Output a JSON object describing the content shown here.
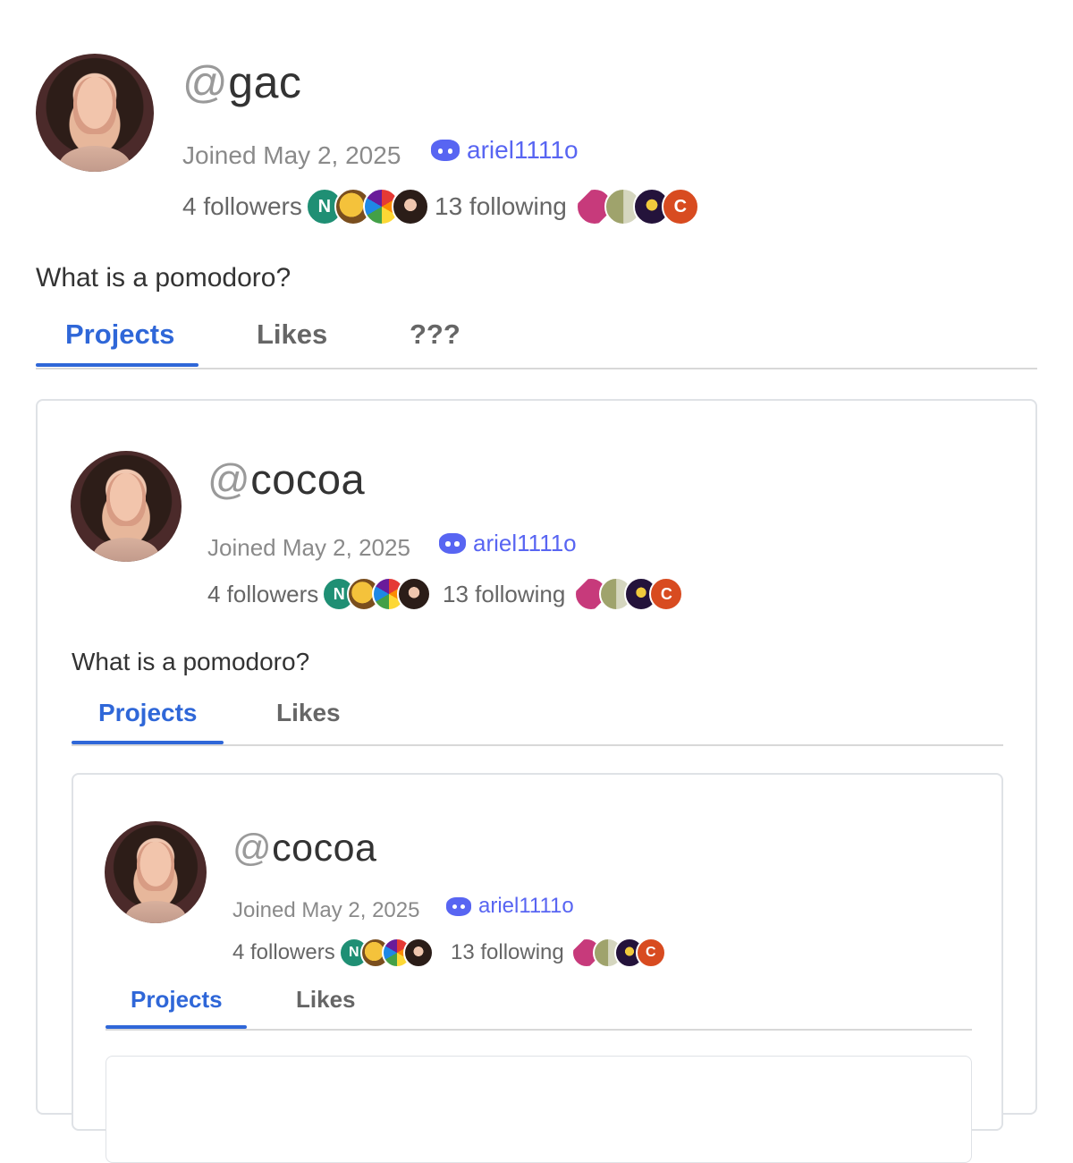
{
  "profile": {
    "at": "@",
    "username": "gac",
    "joined": "Joined May 2, 2025",
    "discord": "ariel1111o",
    "followers": "4 followers",
    "following": "13 following",
    "bio": "What is a pomodoro?",
    "tabs": [
      "Projects",
      "Likes",
      "???"
    ]
  },
  "nested_profile_1": {
    "at": "@",
    "username": "cocoa",
    "joined": "Joined May 2, 2025",
    "discord": "ariel1111o",
    "followers": "4 followers",
    "following": "13 following",
    "bio": "What is a pomodoro?",
    "tabs": [
      "Projects",
      "Likes"
    ]
  },
  "nested_profile_2": {
    "at": "@",
    "username": "cocoa",
    "joined": "Joined May 2, 2025",
    "discord": "ariel1111o",
    "followers": "4 followers",
    "following": "13 following",
    "tabs": [
      "Projects",
      "Likes"
    ]
  },
  "icons": {
    "discord": "discord-icon",
    "follower_avatars": [
      "n-avatar",
      "troll-face-avatar",
      "pride-avatar",
      "woman-avatar"
    ],
    "following_avatars": [
      "pink-shoe-avatar",
      "tan-avatar",
      "dark-avatar",
      "c-avatar"
    ]
  },
  "colors": {
    "accent": "#2f67d8",
    "discord": "#5865f2",
    "divider": "#d8d8d8"
  }
}
